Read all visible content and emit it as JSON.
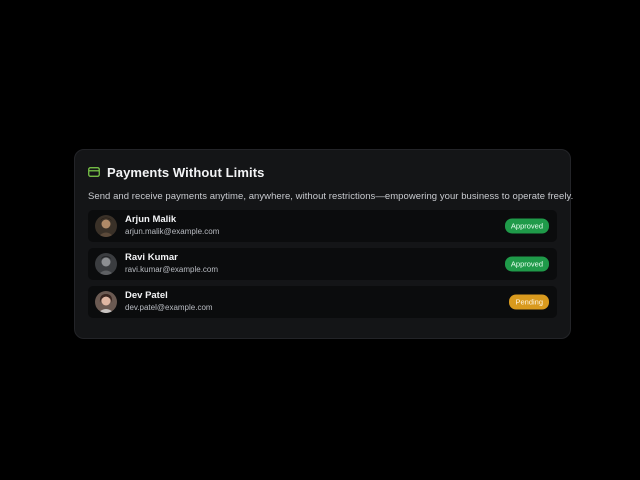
{
  "card": {
    "title": "Payments Without Limits",
    "icon": "credit-card-icon",
    "description": "Send and receive payments anytime, anywhere, without restrictions—empowering your business to operate freely."
  },
  "users": [
    {
      "name": "Arjun Malik",
      "email": "arjun.malik@example.com",
      "status": "Approved",
      "status_color": "#1f9a49",
      "avatar": "avatar-photo"
    },
    {
      "name": "Ravi Kumar",
      "email": "ravi.kumar@example.com",
      "status": "Approved",
      "status_color": "#1f9a49",
      "avatar": "avatar-photo"
    },
    {
      "name": "Dev Patel",
      "email": "dev.patel@example.com",
      "status": "Pending",
      "status_color": "#d99a1e",
      "avatar": "avatar-photo"
    }
  ],
  "colors": {
    "background": "#000000",
    "card": "#141517",
    "row": "#0b0c0d",
    "accent": "#7fd04b"
  }
}
